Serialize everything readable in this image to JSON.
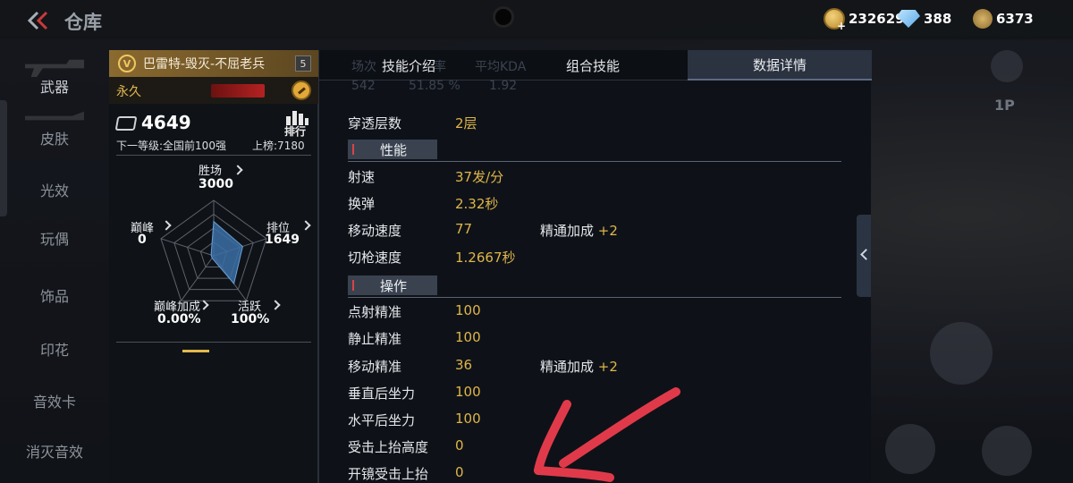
{
  "header": {
    "title": "仓库",
    "currency_gold": "232629",
    "currency_diamond": "388",
    "currency_medal": "6373"
  },
  "sidebar": {
    "items": [
      {
        "label": "武器"
      },
      {
        "label": "皮肤"
      },
      {
        "label": "光效"
      },
      {
        "label": "玩偶"
      },
      {
        "label": "饰品"
      },
      {
        "label": "印花"
      },
      {
        "label": "音效卡"
      },
      {
        "label": "消灭音效"
      }
    ]
  },
  "weapon": {
    "name": "巴雷特-毁灭-不屈老兵",
    "level": "5",
    "duration": "永久",
    "score": "4649",
    "rank_label": "排行",
    "next_level": "下一等级:全国前100强",
    "leaderboard": "上榜:7180"
  },
  "radar": {
    "wins_label": "胜场",
    "wins_value": "3000",
    "rank_label": "排位",
    "rank_value": "1649",
    "active_label": "活跃",
    "active_value": "100%",
    "peak_bonus_label": "巅峰加成",
    "peak_bonus_value": "0.00%",
    "peak_label": "巅峰",
    "peak_value": "0",
    "levels": {
      "wins": 0.62,
      "rank": 0.55,
      "active": 0.62,
      "peak_bonus": 0.05,
      "peak": 0.05
    }
  },
  "tabs": [
    {
      "label": "技能介绍"
    },
    {
      "label": "组合技能"
    },
    {
      "label": "数据详情"
    }
  ],
  "ghost_stats": {
    "headers": [
      "场次",
      "率",
      "平均KDA"
    ],
    "values": [
      "542",
      "51.85 %",
      "1.92"
    ]
  },
  "details": {
    "penetration": {
      "label": "穿透层数",
      "value": "2层"
    },
    "performance_header": "性能",
    "fire_rate": {
      "label": "射速",
      "value": "37发/分"
    },
    "reload": {
      "label": "换弹",
      "value": "2.32秒"
    },
    "move_speed": {
      "label": "移动速度",
      "value": "77",
      "bonus_label": "精通加成",
      "bonus_value": "+2"
    },
    "switch_speed": {
      "label": "切枪速度",
      "value": "1.2667秒"
    },
    "operation_header": "操作",
    "tap_accuracy": {
      "label": "点射精准",
      "value": "100"
    },
    "still_accuracy": {
      "label": "静止精准",
      "value": "100"
    },
    "move_accuracy": {
      "label": "移动精准",
      "value": "36",
      "bonus_label": "精通加成",
      "bonus_value": "+2"
    },
    "vertical_recoil": {
      "label": "垂直后坐力",
      "value": "100"
    },
    "horizontal_recoil": {
      "label": "水平后坐力",
      "value": "100"
    },
    "hit_flinch": {
      "label": "受击上抬高度",
      "value": "0"
    },
    "scope_hit_flinch": {
      "label": "开镜受击上抬",
      "value": "0"
    }
  },
  "hud": {
    "view_label": "1P"
  },
  "colors": {
    "accent_gold": "#e0b54a",
    "annotation_red": "#e03a4a"
  }
}
